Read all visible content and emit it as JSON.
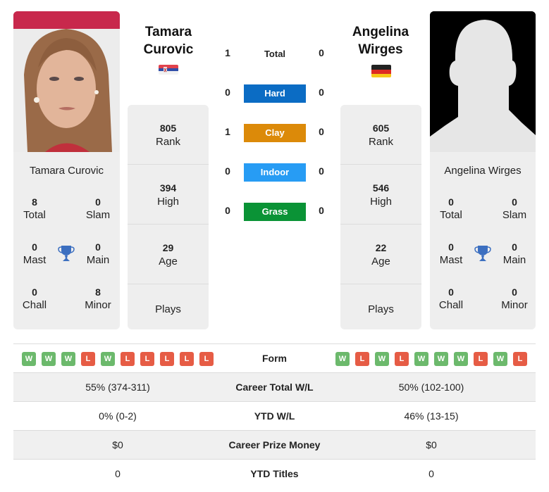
{
  "colors": {
    "hard": "#0b6cc4",
    "clay": "#dc8a09",
    "indoor": "#279cf4",
    "grass": "#0a9336",
    "win": "#6cb96c",
    "loss": "#e65c45",
    "trophy": "#3c6fc0"
  },
  "player1": {
    "name": "Tamara Curovic",
    "name_line1": "Tamara",
    "name_line2": "Curovic",
    "flag": "serbia-flag",
    "titles": {
      "total": {
        "value": "8",
        "label": "Total"
      },
      "slam": {
        "value": "0",
        "label": "Slam"
      },
      "mast": {
        "value": "0",
        "label": "Mast"
      },
      "main": {
        "value": "0",
        "label": "Main"
      },
      "chall": {
        "value": "0",
        "label": "Chall"
      },
      "minor": {
        "value": "8",
        "label": "Minor"
      }
    },
    "rank": {
      "value": "805",
      "label": "Rank"
    },
    "high": {
      "value": "394",
      "label": "High"
    },
    "age": {
      "value": "29",
      "label": "Age"
    },
    "plays": {
      "label": "Plays"
    },
    "form": [
      "W",
      "W",
      "W",
      "L",
      "W",
      "L",
      "L",
      "L",
      "L",
      "L"
    ],
    "career_wl": "55% (374-311)",
    "ytd_wl": "0% (0-2)",
    "prize": "$0",
    "ytd_titles": "0"
  },
  "player2": {
    "name": "Angelina Wirges",
    "name_line1": "Angelina",
    "name_line2": "Wirges",
    "flag": "germany-flag",
    "titles": {
      "total": {
        "value": "0",
        "label": "Total"
      },
      "slam": {
        "value": "0",
        "label": "Slam"
      },
      "mast": {
        "value": "0",
        "label": "Mast"
      },
      "main": {
        "value": "0",
        "label": "Main"
      },
      "chall": {
        "value": "0",
        "label": "Chall"
      },
      "minor": {
        "value": "0",
        "label": "Minor"
      }
    },
    "rank": {
      "value": "605",
      "label": "Rank"
    },
    "high": {
      "value": "546",
      "label": "High"
    },
    "age": {
      "value": "22",
      "label": "Age"
    },
    "plays": {
      "label": "Plays"
    },
    "form": [
      "W",
      "L",
      "W",
      "L",
      "W",
      "W",
      "W",
      "L",
      "W",
      "L"
    ],
    "career_wl": "50% (102-100)",
    "ytd_wl": "46% (13-15)",
    "prize": "$0",
    "ytd_titles": "0"
  },
  "h2h": {
    "total": {
      "label": "Total",
      "p1": "1",
      "p2": "0"
    },
    "hard": {
      "label": "Hard",
      "p1": "0",
      "p2": "0"
    },
    "clay": {
      "label": "Clay",
      "p1": "1",
      "p2": "0"
    },
    "indoor": {
      "label": "Indoor",
      "p1": "0",
      "p2": "0"
    },
    "grass": {
      "label": "Grass",
      "p1": "0",
      "p2": "0"
    }
  },
  "table": {
    "form_label": "Form",
    "career_wl_label": "Career Total W/L",
    "ytd_wl_label": "YTD W/L",
    "prize_label": "Career Prize Money",
    "ytd_titles_label": "YTD Titles"
  }
}
